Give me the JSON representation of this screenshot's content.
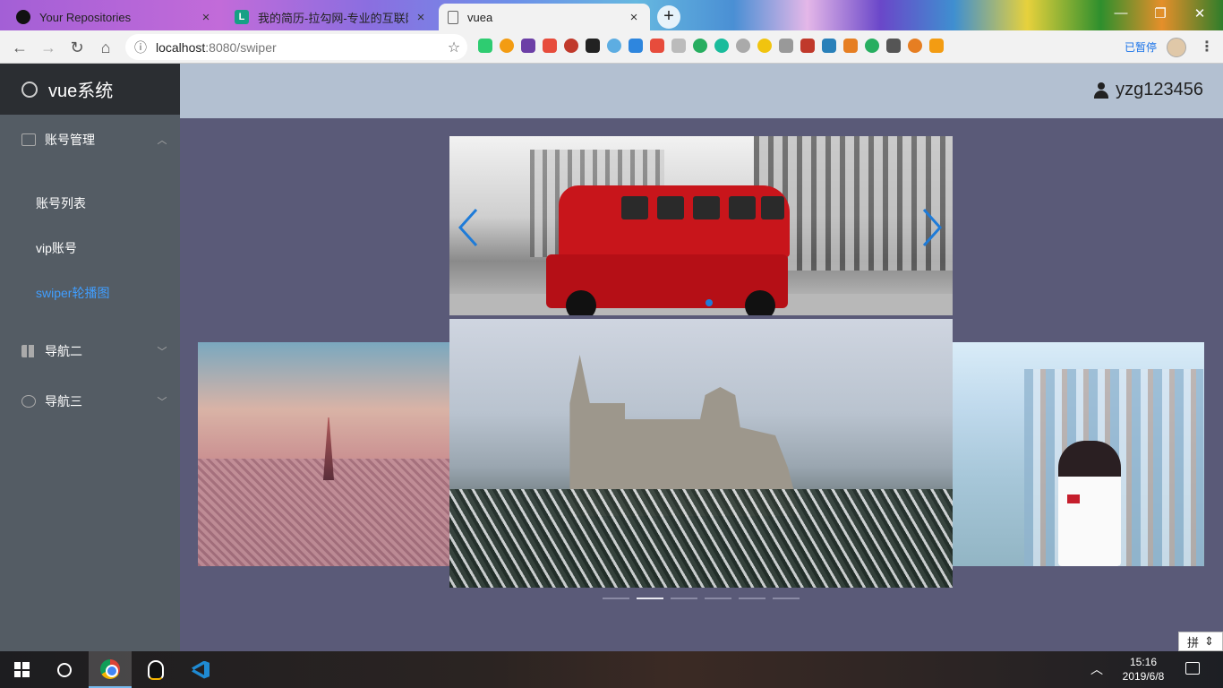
{
  "browser": {
    "tabs": [
      {
        "title": "Your Repositories",
        "close": "×"
      },
      {
        "title": "我的简历-拉勾网-专业的互联网",
        "close": "×"
      },
      {
        "title": "vuea",
        "close": "×"
      }
    ],
    "new_tab": "+",
    "url_host": "localhost",
    "url_path": ":8080/swiper",
    "paused_label": "已暂停",
    "window_controls": {
      "minimize": "—",
      "maximize": "❐",
      "close": "✕"
    }
  },
  "sidebar": {
    "logo_text": "vue系统",
    "groups": [
      {
        "label": "账号管理",
        "icon": "envelope-icon",
        "expanded": true,
        "items": [
          {
            "label": "账号列表",
            "active": false
          },
          {
            "label": "vip账号",
            "active": false
          },
          {
            "label": "swiper轮播图",
            "active": true
          }
        ]
      },
      {
        "label": "导航二",
        "icon": "grid-icon",
        "expanded": false
      },
      {
        "label": "导航三",
        "icon": "gear-icon",
        "expanded": false
      }
    ]
  },
  "header": {
    "username": "yzg123456"
  },
  "swiper": {
    "top_slide_count": 1,
    "coverflow_slides": [
      "paris",
      "castle",
      "anime"
    ],
    "pager_count": 6,
    "pager_active_index": 1
  },
  "taskbar": {
    "time": "15:16",
    "date": "2019/6/8",
    "ime": "拼"
  },
  "colors": {
    "active_menu": "#409eff",
    "sidebar": "#545c64",
    "header": "#b3c0d1",
    "main": "#5a5a78"
  }
}
